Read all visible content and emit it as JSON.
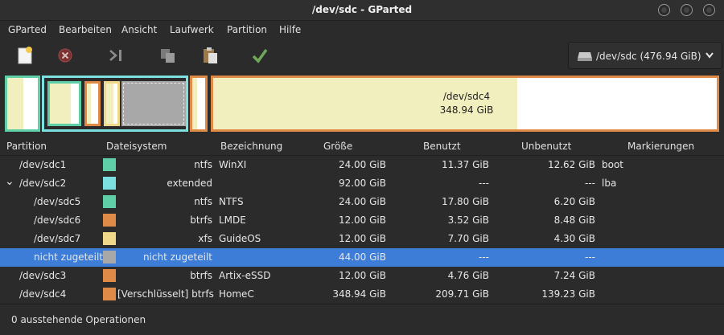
{
  "window": {
    "title": "/dev/sdc - GParted"
  },
  "menu": [
    "GParted",
    "Bearbeiten",
    "Ansicht",
    "Laufwerk",
    "Partition",
    "Hilfe"
  ],
  "toolbar": {
    "icons": [
      "new-partition-icon",
      "delete-icon",
      "resize-move-icon",
      "copy-icon",
      "paste-icon",
      "apply-icon"
    ]
  },
  "device": {
    "label": "/dev/sdc (476.94 GiB)"
  },
  "map": {
    "selected_name": "/dev/sdc4",
    "selected_size": "348.94 GiB"
  },
  "columns": [
    "Partition",
    "Dateisystem",
    "Bezeichnung",
    "Größe",
    "Benutzt",
    "Unbenutzt",
    "Markierungen"
  ],
  "colors": {
    "ntfs": "#5fcfa8",
    "extended": "#7de0e0",
    "btrfs": "#e08a48",
    "xfs": "#f0d88a",
    "unallocated": "#a8a8a8",
    "selection": "#3d7dd8"
  },
  "rows": [
    {
      "partition": "/dev/sdc1",
      "fs": "ntfs",
      "label": "WinXI",
      "size": "24.00 GiB",
      "used": "11.37 GiB",
      "unused": "12.62 GiB",
      "flags": "boot",
      "color": "#5fcfa8",
      "indent": 0,
      "expander": ""
    },
    {
      "partition": "/dev/sdc2",
      "fs": "extended",
      "label": "",
      "size": "92.00 GiB",
      "used": "---",
      "unused": "---",
      "flags": "lba",
      "color": "#7de0e0",
      "indent": 0,
      "expander": "⌄"
    },
    {
      "partition": "/dev/sdc5",
      "fs": "ntfs",
      "label": "NTFS",
      "size": "24.00 GiB",
      "used": "17.80 GiB",
      "unused": "6.20 GiB",
      "flags": "",
      "color": "#5fcfa8",
      "indent": 1,
      "expander": ""
    },
    {
      "partition": "/dev/sdc6",
      "fs": "btrfs",
      "label": "LMDE",
      "size": "12.00 GiB",
      "used": "3.52 GiB",
      "unused": "8.48 GiB",
      "flags": "",
      "color": "#e08a48",
      "indent": 1,
      "expander": ""
    },
    {
      "partition": "/dev/sdc7",
      "fs": "xfs",
      "label": "GuideOS",
      "size": "12.00 GiB",
      "used": "7.70 GiB",
      "unused": "4.30 GiB",
      "flags": "",
      "color": "#f0d88a",
      "indent": 1,
      "expander": ""
    },
    {
      "partition": "nicht zugeteilt",
      "fs": "nicht zugeteilt",
      "label": "",
      "size": "44.00 GiB",
      "used": "---",
      "unused": "---",
      "flags": "",
      "color": "#a8a8a8",
      "indent": 1,
      "expander": "",
      "selected": true
    },
    {
      "partition": "/dev/sdc3",
      "fs": "btrfs",
      "label": "Artix-eSSD",
      "size": "12.00 GiB",
      "used": "4.76 GiB",
      "unused": "7.24 GiB",
      "flags": "",
      "color": "#e08a48",
      "indent": 0,
      "expander": ""
    },
    {
      "partition": "/dev/sdc4",
      "fs": "[Verschlüsselt] btrfs",
      "label": "HomeC",
      "size": "348.94 GiB",
      "used": "209.71 GiB",
      "unused": "139.23 GiB",
      "flags": "",
      "color": "#e08a48",
      "indent": 0,
      "expander": ""
    }
  ],
  "status": "0 ausstehende Operationen"
}
